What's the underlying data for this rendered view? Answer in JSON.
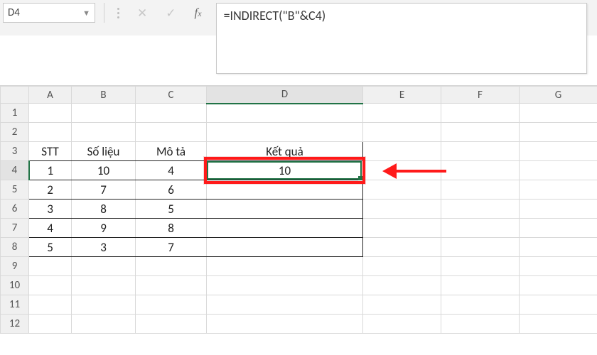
{
  "nameBox": {
    "value": "D4"
  },
  "formulaBar": {
    "value": "=INDIRECT(\"B\"&C4)"
  },
  "columns": [
    "A",
    "B",
    "C",
    "D",
    "E",
    "F",
    "G"
  ],
  "rows": [
    "1",
    "2",
    "3",
    "4",
    "5",
    "6",
    "7",
    "8",
    "9",
    "10",
    "11",
    "12"
  ],
  "headers": {
    "A": "STT",
    "B": "Số liệu",
    "C": "Mô tả",
    "D": "Kết quả"
  },
  "data": [
    {
      "stt": "1",
      "solieu": "10",
      "mota": "4",
      "ketqua": "10"
    },
    {
      "stt": "2",
      "solieu": "7",
      "mota": "6",
      "ketqua": ""
    },
    {
      "stt": "3",
      "solieu": "8",
      "mota": "5",
      "ketqua": ""
    },
    {
      "stt": "4",
      "solieu": "9",
      "mota": "8",
      "ketqua": ""
    },
    {
      "stt": "5",
      "solieu": "3",
      "mota": "7",
      "ketqua": ""
    }
  ],
  "activeCell": "D4",
  "chart_data": {
    "type": "table",
    "title": "",
    "columns": [
      "STT",
      "Số liệu",
      "Mô tả",
      "Kết quả"
    ],
    "rows": [
      [
        1,
        10,
        4,
        10
      ],
      [
        2,
        7,
        6,
        null
      ],
      [
        3,
        8,
        5,
        null
      ],
      [
        4,
        9,
        8,
        null
      ],
      [
        5,
        3,
        7,
        null
      ]
    ]
  }
}
